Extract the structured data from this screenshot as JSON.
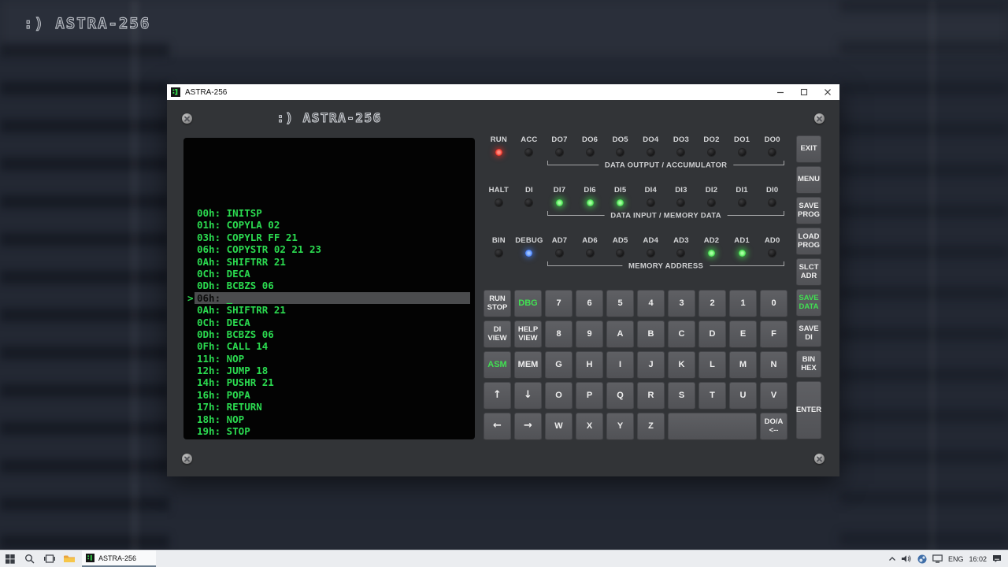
{
  "desktop": {
    "logo": ":) ASTRA-256"
  },
  "window": {
    "title": "ASTRA-256",
    "header_logo": ":) ASTRA-256"
  },
  "terminal": {
    "lines": [
      {
        "addr": "00h:",
        "text": "INITSP"
      },
      {
        "addr": "01h:",
        "text": "COPYLA 02"
      },
      {
        "addr": "03h:",
        "text": "COPYLR FF 21"
      },
      {
        "addr": "06h:",
        "text": "COPYSTR 02 21 23"
      },
      {
        "addr": "0Ah:",
        "text": "SHIFTRR 21"
      },
      {
        "addr": "0Ch:",
        "text": "DECA"
      },
      {
        "addr": "0Dh:",
        "text": "BCBZS 06"
      },
      {
        "addr": "06h:",
        "text": "",
        "active": true,
        "prompt": ">",
        "cursor": "_"
      },
      {
        "addr": "0Ah:",
        "text": "SHIFTRR 21"
      },
      {
        "addr": "0Ch:",
        "text": "DECA"
      },
      {
        "addr": "0Dh:",
        "text": "BCBZS 06"
      },
      {
        "addr": "0Fh:",
        "text": "CALL 14"
      },
      {
        "addr": "11h:",
        "text": "NOP"
      },
      {
        "addr": "12h:",
        "text": "JUMP 18"
      },
      {
        "addr": "14h:",
        "text": "PUSHR 21"
      },
      {
        "addr": "16h:",
        "text": "POPA"
      },
      {
        "addr": "17h:",
        "text": "RETURN"
      },
      {
        "addr": "18h:",
        "text": "NOP"
      },
      {
        "addr": "19h:",
        "text": "STOP"
      }
    ]
  },
  "led_banks": [
    {
      "name": "bank-output-accumulator",
      "bracket": "DATA OUTPUT / ACCUMULATOR",
      "leds": [
        {
          "label": "RUN",
          "state": "red"
        },
        {
          "label": "ACC",
          "state": "off"
        },
        {
          "label": "DO7",
          "state": "off"
        },
        {
          "label": "DO6",
          "state": "off"
        },
        {
          "label": "DO5",
          "state": "off"
        },
        {
          "label": "DO4",
          "state": "off"
        },
        {
          "label": "DO3",
          "state": "off"
        },
        {
          "label": "DO2",
          "state": "off"
        },
        {
          "label": "DO1",
          "state": "off"
        },
        {
          "label": "DO0",
          "state": "off"
        }
      ]
    },
    {
      "name": "bank-input-memory-data",
      "bracket": "DATA INPUT / MEMORY DATA",
      "leds": [
        {
          "label": "HALT",
          "state": "off"
        },
        {
          "label": "DI",
          "state": "off"
        },
        {
          "label": "DI7",
          "state": "green"
        },
        {
          "label": "DI6",
          "state": "green"
        },
        {
          "label": "DI5",
          "state": "green"
        },
        {
          "label": "DI4",
          "state": "off"
        },
        {
          "label": "DI3",
          "state": "off"
        },
        {
          "label": "DI2",
          "state": "off"
        },
        {
          "label": "DI1",
          "state": "off"
        },
        {
          "label": "DI0",
          "state": "off"
        }
      ]
    },
    {
      "name": "bank-memory-address",
      "bracket": "MEMORY ADDRESS",
      "leds": [
        {
          "label": "BIN",
          "state": "off"
        },
        {
          "label": "DEBUG",
          "state": "blue"
        },
        {
          "label": "AD7",
          "state": "off"
        },
        {
          "label": "AD6",
          "state": "off"
        },
        {
          "label": "AD5",
          "state": "off"
        },
        {
          "label": "AD4",
          "state": "off"
        },
        {
          "label": "AD3",
          "state": "off"
        },
        {
          "label": "AD2",
          "state": "green"
        },
        {
          "label": "AD1",
          "state": "green"
        },
        {
          "label": "AD0",
          "state": "off"
        }
      ]
    }
  ],
  "keypad": {
    "rows": [
      [
        {
          "label": "RUN\nSTOP",
          "small": true,
          "name": "key-run-stop"
        },
        {
          "label": "DBG",
          "accent": true
        },
        {
          "label": "7"
        },
        {
          "label": "6"
        },
        {
          "label": "5"
        },
        {
          "label": "4"
        },
        {
          "label": "3"
        },
        {
          "label": "2"
        },
        {
          "label": "1"
        },
        {
          "label": "0"
        }
      ],
      [
        {
          "label": "DI\nVIEW",
          "small": true,
          "name": "key-di-view"
        },
        {
          "label": "HELP\nVIEW",
          "small": true,
          "name": "key-help-view"
        },
        {
          "label": "8"
        },
        {
          "label": "9"
        },
        {
          "label": "A"
        },
        {
          "label": "B"
        },
        {
          "label": "C"
        },
        {
          "label": "D"
        },
        {
          "label": "E"
        },
        {
          "label": "F"
        }
      ],
      [
        {
          "label": "ASM",
          "accent": true
        },
        {
          "label": "MEM"
        },
        {
          "label": "G"
        },
        {
          "label": "H"
        },
        {
          "label": "I"
        },
        {
          "label": "J"
        },
        {
          "label": "K"
        },
        {
          "label": "L"
        },
        {
          "label": "M"
        },
        {
          "label": "N"
        }
      ],
      [
        {
          "label": "↑",
          "arrow": true,
          "name": "key-arrow-up"
        },
        {
          "label": "↓",
          "arrow": true,
          "name": "key-arrow-down"
        },
        {
          "label": "O"
        },
        {
          "label": "P"
        },
        {
          "label": "Q"
        },
        {
          "label": "R"
        },
        {
          "label": "S"
        },
        {
          "label": "T"
        },
        {
          "label": "U"
        },
        {
          "label": "V"
        }
      ],
      [
        {
          "label": "←",
          "arrow": true,
          "name": "key-arrow-left"
        },
        {
          "label": "→",
          "arrow": true,
          "name": "key-arrow-right"
        },
        {
          "label": "W"
        },
        {
          "label": "X"
        },
        {
          "label": "Y"
        },
        {
          "label": "Z"
        },
        {
          "label": "",
          "span": 3,
          "name": "key-space"
        },
        {
          "label": "DO/A\n<--",
          "small": true,
          "name": "key-do-a"
        }
      ]
    ]
  },
  "side_buttons": [
    {
      "label": "EXIT"
    },
    {
      "label": "MENU"
    },
    {
      "label": "SAVE\nPROG",
      "name": "save-prog-button"
    },
    {
      "label": "LOAD\nPROG",
      "name": "load-prog-button"
    },
    {
      "label": "SLCT\nADR",
      "name": "slct-adr-button"
    },
    {
      "label": "SAVE\nDATA",
      "accent": true,
      "name": "save-data-button"
    },
    {
      "label": "SAVE\nDI",
      "name": "save-di-button"
    },
    {
      "label": "BIN\nHEX",
      "name": "bin-hex-button"
    },
    {
      "label": "ENTER",
      "tall": true
    }
  ],
  "taskbar": {
    "app_label": "ASTRA-256",
    "tray": {
      "language": "ENG",
      "time": "16:02"
    }
  },
  "colors": {
    "panel": "#323437",
    "terminal_green": "#2bdb50",
    "accent_green": "#41e052",
    "led_red": "#ef2a1e",
    "led_green": "#37d843",
    "led_blue": "#3f7bff",
    "taskbar_active_underline": "#6b7d8f"
  }
}
